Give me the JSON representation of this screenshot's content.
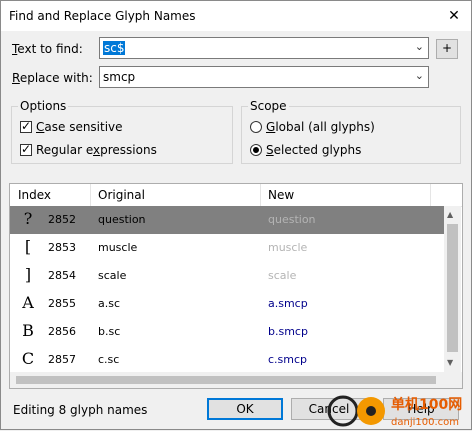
{
  "window": {
    "title": "Find and Replace Glyph Names",
    "close_glyph": "✕"
  },
  "find": {
    "label_u": "T",
    "label_rest": "ext to find:",
    "value": "sc$",
    "add_label": "+"
  },
  "replace": {
    "label_u": "R",
    "label_rest": "eplace with:",
    "value": "smcp"
  },
  "options": {
    "title": "Options",
    "case_u": "C",
    "case_rest": "ase sensitive",
    "regex_pre": "Regular e",
    "regex_u": "x",
    "regex_rest": "pressions"
  },
  "scope": {
    "title": "Scope",
    "global_u": "G",
    "global_rest": "lobal (all glyphs)",
    "selected_u": "S",
    "selected_rest": "elected glyphs"
  },
  "table": {
    "headers": {
      "index": "Index",
      "original": "Original",
      "new": "New"
    },
    "rows": [
      {
        "glyph": "?",
        "index": "2852",
        "original": "question",
        "new": "question"
      },
      {
        "glyph": "[",
        "index": "2853",
        "original": "muscle",
        "new": "muscle"
      },
      {
        "glyph": "]",
        "index": "2854",
        "original": "scale",
        "new": "scale"
      },
      {
        "glyph": "A",
        "index": "2855",
        "original": "a.sc",
        "new": "a.smcp"
      },
      {
        "glyph": "B",
        "index": "2856",
        "original": "b.sc",
        "new": "b.smcp"
      },
      {
        "glyph": "C",
        "index": "2857",
        "original": "c.sc",
        "new": "c.smcp"
      }
    ]
  },
  "status": "Editing 8 glyph names",
  "buttons": {
    "ok": "OK",
    "cancel": "Cancel",
    "help": "Help"
  },
  "watermark": {
    "text": "单机100网",
    "sub": "danji100.com"
  },
  "colors": {
    "selected_row": "#808080",
    "changed_new": "#00008b",
    "unchanged_new": "#b4b4b4",
    "accent": "#0078d7"
  }
}
